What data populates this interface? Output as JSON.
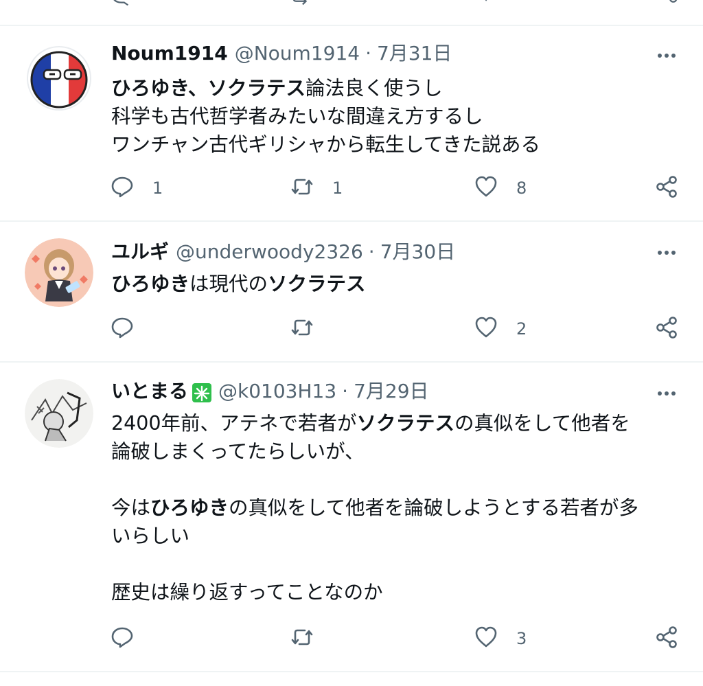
{
  "tweets": [
    {
      "name": "Noum1914",
      "handle": "@Noum1914",
      "separator": "·",
      "date": "7月31日",
      "lines": [
        [
          {
            "t": "ひろゆき、ソクラテス",
            "b": true
          },
          {
            "t": "論法良く使うし",
            "b": false
          }
        ],
        [
          {
            "t": "科学も古代哲学者みたいな間違え方するし",
            "b": false
          }
        ],
        [
          {
            "t": "ワンチャン古代ギリシャから転生してきた説ある",
            "b": false
          }
        ]
      ],
      "replies": "1",
      "retweets": "1",
      "likes": "8"
    },
    {
      "name": "ユルギ",
      "handle": "@underwoody2326",
      "separator": "·",
      "date": "7月30日",
      "lines": [
        [
          {
            "t": "ひろゆき",
            "b": true
          },
          {
            "t": "は現代の",
            "b": false
          },
          {
            "t": "ソクラテス",
            "b": true
          }
        ]
      ],
      "replies": "",
      "retweets": "",
      "likes": "2"
    },
    {
      "name": "いとまる",
      "handle": "@k0103H13",
      "separator": "·",
      "date": "7月29日",
      "lines": [
        [
          {
            "t": "2400年前、アテネで若者が",
            "b": false
          },
          {
            "t": "ソクラテス",
            "b": true
          },
          {
            "t": "の真似をして他者を",
            "b": false
          }
        ],
        [
          {
            "t": "論破しまくってたらしいが、",
            "b": false
          }
        ],
        [],
        [
          {
            "t": "今は",
            "b": false
          },
          {
            "t": "ひろゆき",
            "b": true
          },
          {
            "t": "の真似をして他者を論破しようとする若者が多",
            "b": false
          }
        ],
        [
          {
            "t": "いらしい",
            "b": false
          }
        ],
        [],
        [
          {
            "t": "歴史は繰り返すってことなのか",
            "b": false
          }
        ]
      ],
      "replies": "",
      "retweets": "",
      "likes": "3"
    }
  ],
  "icons": {
    "reply": "reply-icon",
    "retweet": "retweet-icon",
    "like": "like-icon",
    "share": "share-icon",
    "more": "more-icon",
    "verified_badge": "green-sparkle-badge-icon"
  },
  "colors": {
    "text": "#0f1419",
    "muted": "#536471",
    "divider": "#eff3f4",
    "badge": "#2fbf4c"
  }
}
